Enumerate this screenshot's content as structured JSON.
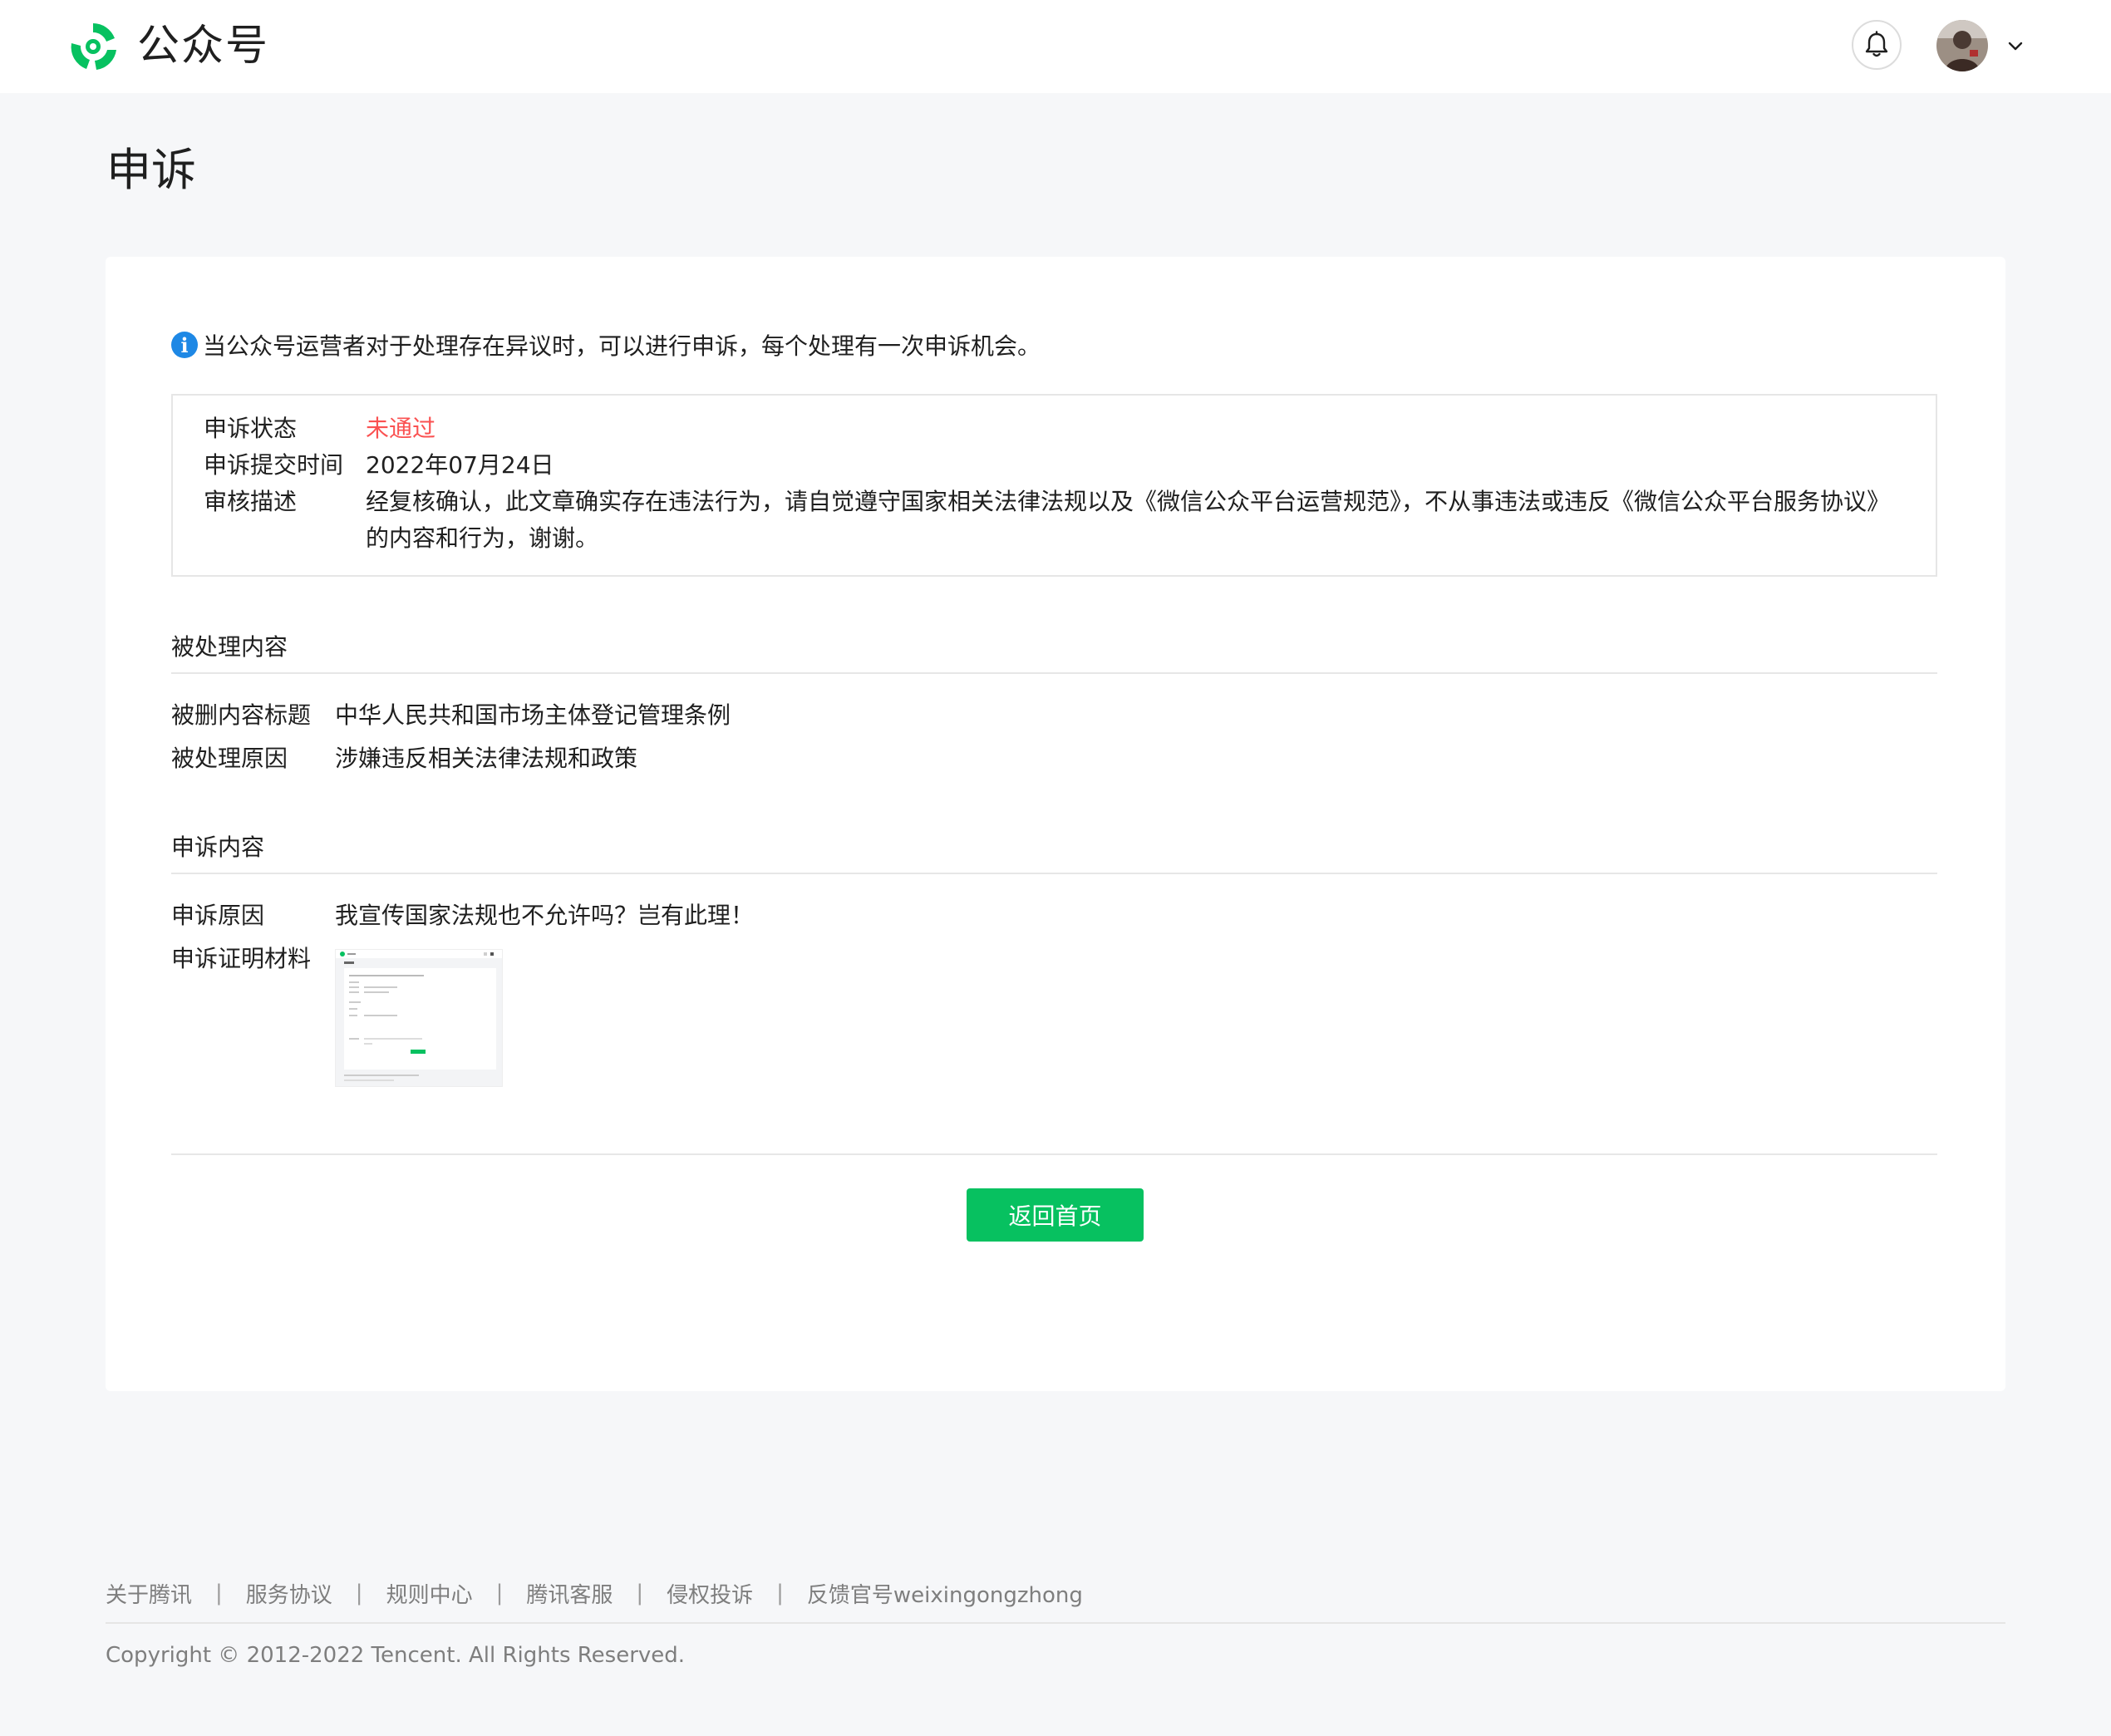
{
  "header": {
    "brand": "公众号",
    "icons": {
      "logo": "wechat-official-account-logo",
      "bell": "bell-icon",
      "avatar": "user-avatar",
      "caret": "chevron-down-icon"
    }
  },
  "page": {
    "title": "申诉"
  },
  "notice": {
    "icon": "info-icon",
    "text": "当公众号运营者对于处理存在异议时，可以进行申诉，每个处理有一次申诉机会。"
  },
  "status": {
    "state_label": "申诉状态",
    "state_value": "未通过",
    "state_color": "#fa5151",
    "time_label": "申诉提交时间",
    "time_value": "2022年07月24日",
    "desc_label": "审核描述",
    "desc_value": "经复核确认，此文章确实存在违法行为，请自觉遵守国家相关法律法规以及《微信公众平台运营规范》，不从事违法或违反《微信公众平台服务协议》的内容和行为，谢谢。"
  },
  "handled": {
    "section_title": "被处理内容",
    "title_label": "被删内容标题",
    "title_value": "中华人民共和国市场主体登记管理条例",
    "reason_label": "被处理原因",
    "reason_value": "涉嫌违反相关法律法规和政策"
  },
  "appeal": {
    "section_title": "申诉内容",
    "reason_label": "申诉原因",
    "reason_value": "我宣传国家法规也不允许吗？岂有此理！",
    "evidence_label": "申诉证明材料"
  },
  "actions": {
    "back_label": "返回首页",
    "primary_color": "#07c160"
  },
  "footer": {
    "links": [
      "关于腾讯",
      "服务协议",
      "规则中心",
      "腾讯客服",
      "侵权投诉",
      "反馈官号weixingongzhong"
    ],
    "separator": "|",
    "copyright": "Copyright © 2012-2022 Tencent. All Rights Reserved."
  }
}
